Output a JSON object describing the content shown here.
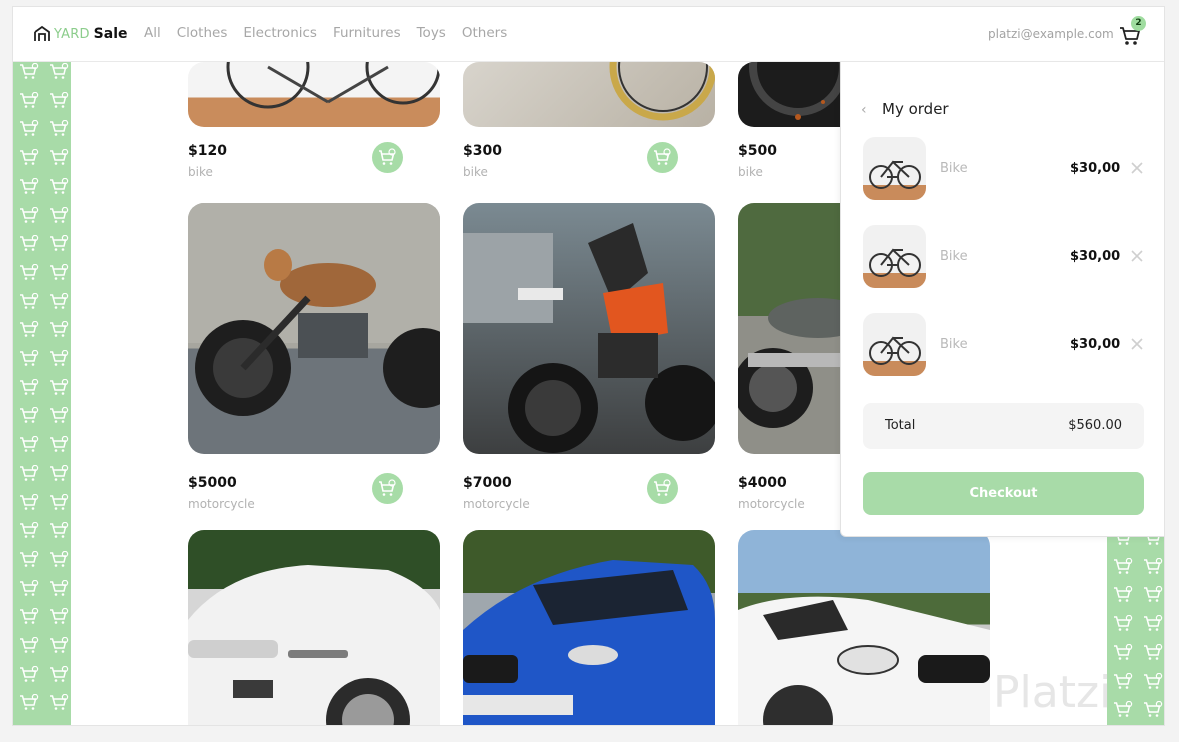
{
  "brand": {
    "part1": "YARD",
    "part2": "Sale"
  },
  "nav": [
    "All",
    "Clothes",
    "Electronics",
    "Furnitures",
    "Toys",
    "Others"
  ],
  "user_email": "platzi@example.com",
  "cart_count": "2",
  "colors": {
    "accent": "#a8dba8",
    "accent_dark": "#8ccd8c"
  },
  "products": [
    {
      "price": "$120",
      "category": "bike"
    },
    {
      "price": "$300",
      "category": "bike"
    },
    {
      "price": "$500",
      "category": "bike"
    },
    {
      "price": "$5000",
      "category": "motorcycle"
    },
    {
      "price": "$7000",
      "category": "motorcycle"
    },
    {
      "price": "$4000",
      "category": "motorcycle"
    },
    {
      "price": "",
      "category": ""
    },
    {
      "price": "",
      "category": ""
    },
    {
      "price": "",
      "category": ""
    }
  ],
  "order": {
    "title": "My order",
    "items": [
      {
        "name": "Bike",
        "price": "$30,00"
      },
      {
        "name": "Bike",
        "price": "$30,00"
      },
      {
        "name": "Bike",
        "price": "$30,00"
      }
    ],
    "total_label": "Total",
    "total_value": "$560.00",
    "checkout_label": "Checkout"
  },
  "watermark": "Platzi"
}
